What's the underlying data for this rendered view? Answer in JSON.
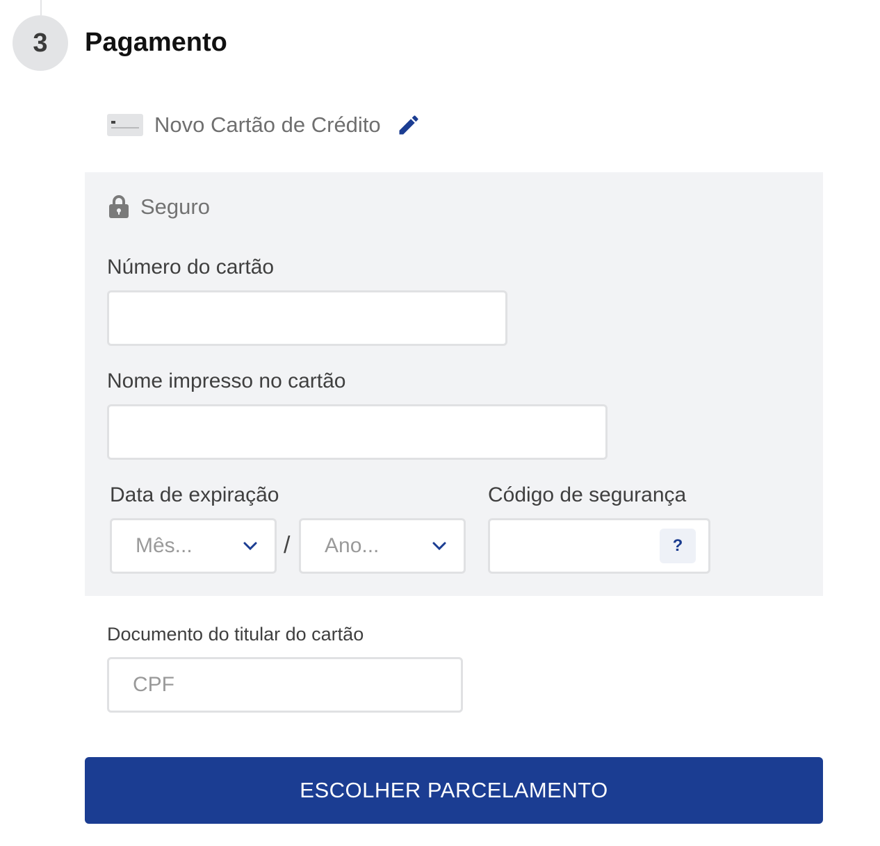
{
  "step": {
    "number": "3",
    "title": "Pagamento"
  },
  "payment_method": {
    "label": "Novo Cartão de Crédito",
    "icon": "credit-card-icon",
    "edit_icon": "pencil-icon"
  },
  "secure": {
    "label": "Seguro",
    "icon": "lock-icon"
  },
  "card_number": {
    "label": "Número do cartão",
    "value": ""
  },
  "card_name": {
    "label": "Nome impresso no cartão",
    "value": ""
  },
  "expiration": {
    "label": "Data de expiração",
    "month_placeholder": "Mês...",
    "separator": "/",
    "year_placeholder": "Ano..."
  },
  "security_code": {
    "label": "Código de segurança",
    "value": "",
    "help_label": "?"
  },
  "holder_document": {
    "label": "Documento do titular do cartão",
    "placeholder": "CPF"
  },
  "submit": {
    "label": "ESCOLHER PARCELAMENTO"
  },
  "colors": {
    "accent": "#1b3d92",
    "panel": "#f2f3f5",
    "border": "#e0e1e3"
  }
}
